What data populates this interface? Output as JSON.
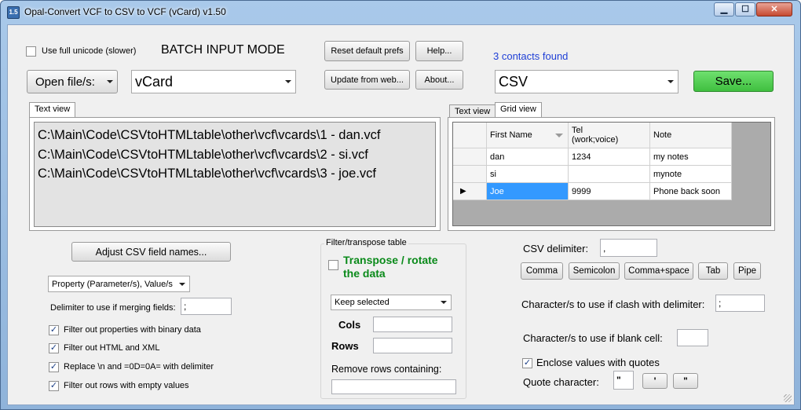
{
  "window": {
    "title": "Opal-Convert VCF to CSV to VCF (vCard) v1.50",
    "icon_text": "1.5"
  },
  "caption_buttons": {
    "minimize": "▁",
    "maximize": "☐",
    "close": "✕"
  },
  "top": {
    "unicode_label": "Use full unicode (slower)",
    "unicode_checked": false,
    "batch_mode": "BATCH INPUT MODE",
    "reset_prefs": "Reset default prefs",
    "help": "Help...",
    "update_web": "Update from web...",
    "about": "About...",
    "contacts_found": "3 contacts found",
    "open_files": "Open file/s:",
    "input_format": "vCard",
    "output_format": "CSV",
    "save": "Save..."
  },
  "left_tabs": {
    "text_view": "Text view"
  },
  "text_view_lines": [
    "C:\\Main\\Code\\CSVtoHTMLtable\\other\\vcf\\vcards\\1 - dan.vcf",
    "C:\\Main\\Code\\CSVtoHTMLtable\\other\\vcf\\vcards\\2 - si.vcf",
    "C:\\Main\\Code\\CSVtoHTMLtable\\other\\vcf\\vcards\\3 - joe.vcf"
  ],
  "right_tabs": {
    "text_view": "Text view",
    "grid_view": "Grid view"
  },
  "grid": {
    "headers": [
      "First Name",
      "Tel\n(work;voice)",
      "Note"
    ],
    "rows": [
      [
        "dan",
        "1234",
        "my notes"
      ],
      [
        "si",
        "",
        "mynote"
      ],
      [
        "Joe",
        "9999",
        "Phone back soon"
      ]
    ],
    "current_row_marker": "▶"
  },
  "left_options": {
    "adjust_button": "Adjust CSV field names...",
    "property_combo": "Property (Parameter/s), Value/s",
    "delimiter_label": "Delimiter to use if merging fields:",
    "delimiter_value": ";",
    "checkboxes": [
      {
        "label": "Filter out properties with binary data",
        "checked": true
      },
      {
        "label": "Filter out HTML and XML",
        "checked": true
      },
      {
        "label": "Replace \\n and =0D=0A= with delimiter",
        "checked": true
      },
      {
        "label": "Filter out rows with empty values",
        "checked": true
      }
    ]
  },
  "filter": {
    "legend": "Filter/transpose table",
    "transpose_label_1": "Transpose / rotate",
    "transpose_label_2": "the data",
    "transpose_checked": false,
    "keep_combo": "Keep selected",
    "cols_label": "Cols",
    "rows_label": "Rows",
    "remove_label": "Remove rows containing:"
  },
  "csv": {
    "delimiter_label": "CSV delimiter:",
    "delimiter_value": ",",
    "presets": [
      "Comma",
      "Semicolon",
      "Comma+space",
      "Tab",
      "Pipe"
    ],
    "clash_label": "Character/s to use if clash with delimiter:",
    "clash_value": ";",
    "blank_label": "Character/s to use if blank cell:",
    "blank_value": "",
    "enclose_label": "Enclose values with quotes",
    "enclose_checked": true,
    "quote_label": "Quote character:",
    "quote_value": "\"",
    "quote_single": "'",
    "quote_double": "\""
  },
  "colors": {
    "accent_blue": "#1f3fd6",
    "save_green": "#4fcf4f",
    "transpose_green": "#0a8a1a",
    "selection_blue": "#3399ff"
  }
}
